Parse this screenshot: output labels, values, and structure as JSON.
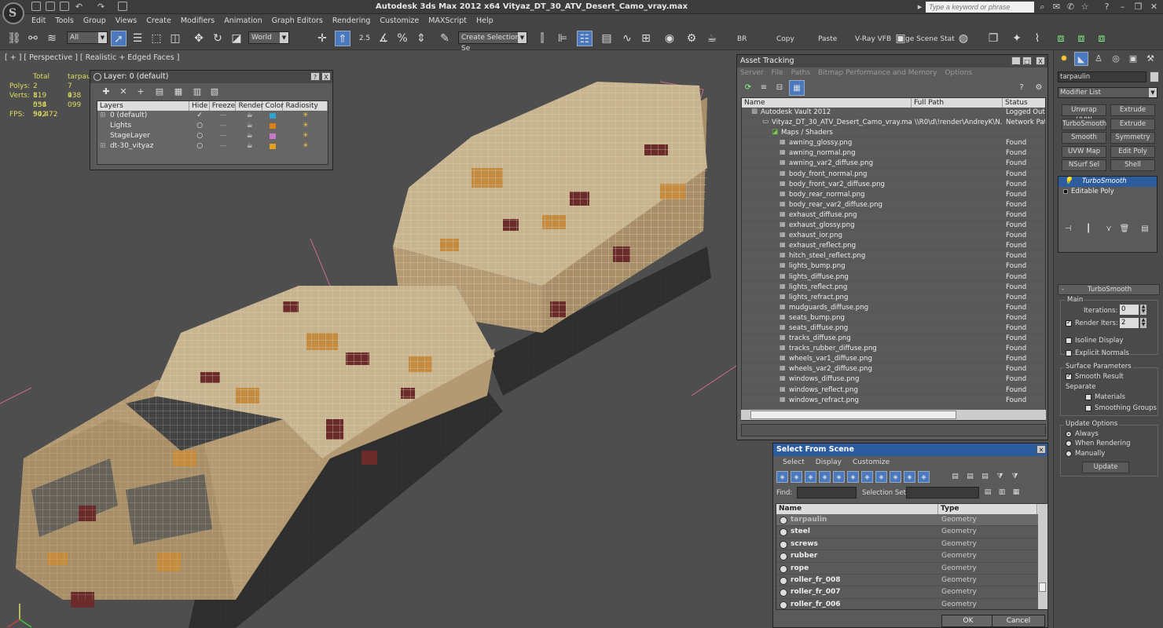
{
  "app": {
    "title": "Autodesk 3ds Max  2012 x64    Vityaz_DT_30_ATV_Desert_Camo_vray.max",
    "logo_letter": "S",
    "search_placeholder": "Type a keyword or phrase"
  },
  "menu": [
    "Edit",
    "Tools",
    "Group",
    "Views",
    "Create",
    "Modifiers",
    "Animation",
    "Graph Editors",
    "Rendering",
    "Customize",
    "MAXScript",
    "Help"
  ],
  "toolbar": {
    "selection_filter": "All",
    "ref_coord": "World",
    "snap_value": "2.5",
    "named_selection": "Create Selection Se",
    "br_label": "BR",
    "copy_label": "Copy",
    "paste_label": "Paste",
    "vray_vfb_label": "V-Ray VFB",
    "scene_state_label": "ge Scene Stat"
  },
  "viewport": {
    "label": "[ + ] [ Perspective ] [ Realistic + Edged Faces ]",
    "stats": {
      "total_label": "Total",
      "object_label": "tarpauli",
      "polys_label": "Polys:",
      "polys_total": "2 819 054",
      "polys_object": "7 938",
      "verts_label": "Verts:",
      "verts_total": "1 538 942",
      "verts_object": "4 099",
      "fps_label": "FPS:",
      "fps_value": "50,472"
    }
  },
  "layer_window": {
    "title": "Layer: 0 (default)",
    "help": "?",
    "close": "X",
    "columns": [
      "Layers",
      "Hide",
      "Freeze",
      "Render",
      "Color",
      "Radiosity"
    ],
    "rows": [
      {
        "name": "0 (default)",
        "color": "#2fa3c8"
      },
      {
        "name": "Lights",
        "color": "#e07f1a"
      },
      {
        "name": "StageLayer",
        "color": "#c878c8"
      },
      {
        "name": "dt-30_vityaz",
        "color": "#e0a020"
      }
    ]
  },
  "asset_tracking": {
    "title": "Asset Tracking",
    "menu": [
      "Server",
      "File",
      "Paths",
      "Bitmap Performance and Memory",
      "Options"
    ],
    "columns": [
      "Name",
      "Full Path",
      "Status"
    ],
    "rows": [
      {
        "name": "Autodesk Vault 2012",
        "path": "",
        "status": "Logged Out (",
        "level": 1
      },
      {
        "name": "Vityaz_DT_30_ATV_Desert_Camo_vray.max",
        "path": "\\\\R0\\d\\!render\\AndreyK\\N...",
        "status": "Network Path",
        "level": 2
      },
      {
        "name": "Maps / Shaders",
        "path": "",
        "status": "",
        "level": 3
      },
      {
        "name": "awning_glossy.png",
        "path": "",
        "status": "Found",
        "level": 4
      },
      {
        "name": "awning_normal.png",
        "path": "",
        "status": "Found",
        "level": 4
      },
      {
        "name": "awning_var2_diffuse.png",
        "path": "",
        "status": "Found",
        "level": 4
      },
      {
        "name": "body_front_normal.png",
        "path": "",
        "status": "Found",
        "level": 4
      },
      {
        "name": "body_front_var2_diffuse.png",
        "path": "",
        "status": "Found",
        "level": 4
      },
      {
        "name": "body_rear_normal.png",
        "path": "",
        "status": "Found",
        "level": 4
      },
      {
        "name": "body_rear_var2_diffuse.png",
        "path": "",
        "status": "Found",
        "level": 4
      },
      {
        "name": "exhaust_diffuse.png",
        "path": "",
        "status": "Found",
        "level": 4
      },
      {
        "name": "exhaust_glossy.png",
        "path": "",
        "status": "Found",
        "level": 4
      },
      {
        "name": "exhaust_ior.png",
        "path": "",
        "status": "Found",
        "level": 4
      },
      {
        "name": "exhaust_reflect.png",
        "path": "",
        "status": "Found",
        "level": 4
      },
      {
        "name": "hitch_steel_reflect.png",
        "path": "",
        "status": "Found",
        "level": 4
      },
      {
        "name": "lights_bump.png",
        "path": "",
        "status": "Found",
        "level": 4
      },
      {
        "name": "lights_diffuse.png",
        "path": "",
        "status": "Found",
        "level": 4
      },
      {
        "name": "lights_reflect.png",
        "path": "",
        "status": "Found",
        "level": 4
      },
      {
        "name": "lights_refract.png",
        "path": "",
        "status": "Found",
        "level": 4
      },
      {
        "name": "mudguards_diffuse.png",
        "path": "",
        "status": "Found",
        "level": 4
      },
      {
        "name": "seats_bump.png",
        "path": "",
        "status": "Found",
        "level": 4
      },
      {
        "name": "seats_diffuse.png",
        "path": "",
        "status": "Found",
        "level": 4
      },
      {
        "name": "tracks_diffuse.png",
        "path": "",
        "status": "Found",
        "level": 4
      },
      {
        "name": "tracks_rubber_diffuse.png",
        "path": "",
        "status": "Found",
        "level": 4
      },
      {
        "name": "wheels_var1_diffuse.png",
        "path": "",
        "status": "Found",
        "level": 4
      },
      {
        "name": "wheels_var2_diffuse.png",
        "path": "",
        "status": "Found",
        "level": 4
      },
      {
        "name": "windows_diffuse.png",
        "path": "",
        "status": "Found",
        "level": 4
      },
      {
        "name": "windows_reflect.png",
        "path": "",
        "status": "Found",
        "level": 4
      },
      {
        "name": "windows_refract.png",
        "path": "",
        "status": "Found",
        "level": 4
      }
    ]
  },
  "select_from_scene": {
    "title": "Select From Scene",
    "menu": [
      "Select",
      "Display",
      "Customize"
    ],
    "find_label": "Find:",
    "selection_set_label": "Selection Set:",
    "columns": [
      "Name",
      "Type"
    ],
    "rows": [
      {
        "name": "tarpaulin",
        "type": "Geometry"
      },
      {
        "name": "steel",
        "type": "Geometry"
      },
      {
        "name": "screws",
        "type": "Geometry"
      },
      {
        "name": "rubber",
        "type": "Geometry"
      },
      {
        "name": "rope",
        "type": "Geometry"
      },
      {
        "name": "roller_fr_008",
        "type": "Geometry"
      },
      {
        "name": "roller_fr_007",
        "type": "Geometry"
      },
      {
        "name": "roller_fr_006",
        "type": "Geometry"
      }
    ],
    "ok_label": "OK",
    "cancel_label": "Cancel"
  },
  "command_panel": {
    "object_name": "tarpaulin",
    "modifier_list": "Modifier List",
    "modifier_buttons": [
      "Unwrap UVW",
      "Extrude",
      "TurboSmooth",
      "Extrude",
      "Smooth",
      "Symmetry",
      "UVW Map",
      "Edit Poly",
      "NSurf Sel",
      "Shell"
    ],
    "stack": [
      "TurboSmooth",
      "Editable Poly"
    ],
    "turbosmooth": {
      "title": "TurboSmooth",
      "collapse": "-",
      "main_label": "Main",
      "iterations_label": "Iterations:",
      "iterations_value": "0",
      "render_iters_label": "Render Iters:",
      "render_iters_value": "2",
      "isoline_label": "Isoline Display",
      "explicit_normals_label": "Explicit Normals",
      "surface_params_label": "Surface Parameters",
      "smooth_result_label": "Smooth Result",
      "separate_label": "Separate",
      "materials_label": "Materials",
      "smoothing_groups_label": "Smoothing Groups",
      "update_options_label": "Update Options",
      "always_label": "Always",
      "when_rendering_label": "When Rendering",
      "manually_label": "Manually",
      "update_button": "Update"
    }
  },
  "colors": {
    "accent": "#2d5c9e",
    "camo_base": "#b39a72",
    "camo_dark": "#6b2b2b",
    "camo_orange": "#c58b3f"
  }
}
